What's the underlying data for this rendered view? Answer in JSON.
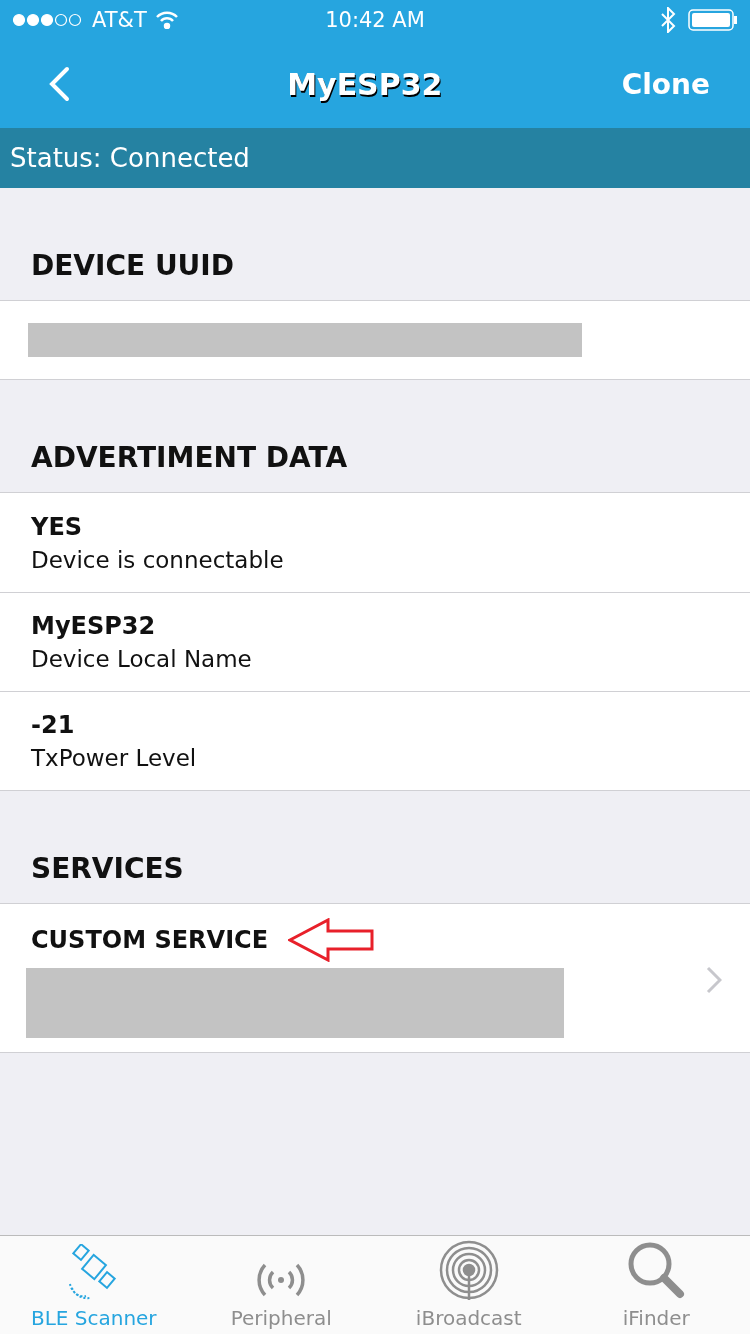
{
  "status_bar": {
    "carrier": "AT&T",
    "time": "10:42 AM"
  },
  "nav": {
    "title": "MyESP32",
    "action": "Clone"
  },
  "connection": {
    "text": "Status: Connected"
  },
  "sections": [
    {
      "title": "DEVICE UUID",
      "rows": [
        {
          "kind": "redacted"
        }
      ]
    },
    {
      "title": "ADVERTIMENT DATA",
      "rows": [
        {
          "kind": "pair",
          "value": "YES",
          "label": "Device is connectable"
        },
        {
          "kind": "pair",
          "value": "MyESP32",
          "label": "Device Local Name"
        },
        {
          "kind": "pair",
          "value": "-21",
          "label": "TxPower Level"
        }
      ]
    },
    {
      "title": "SERVICES",
      "rows": [
        {
          "kind": "service",
          "value": "CUSTOM SERVICE"
        }
      ]
    }
  ],
  "tabs": [
    {
      "label": "BLE Scanner",
      "selected": true,
      "kind": "scanner"
    },
    {
      "label": "Peripheral",
      "selected": false,
      "kind": "peripheral"
    },
    {
      "label": "iBroadcast",
      "selected": false,
      "kind": "broadcast"
    },
    {
      "label": "iFinder",
      "selected": false,
      "kind": "finder"
    }
  ]
}
